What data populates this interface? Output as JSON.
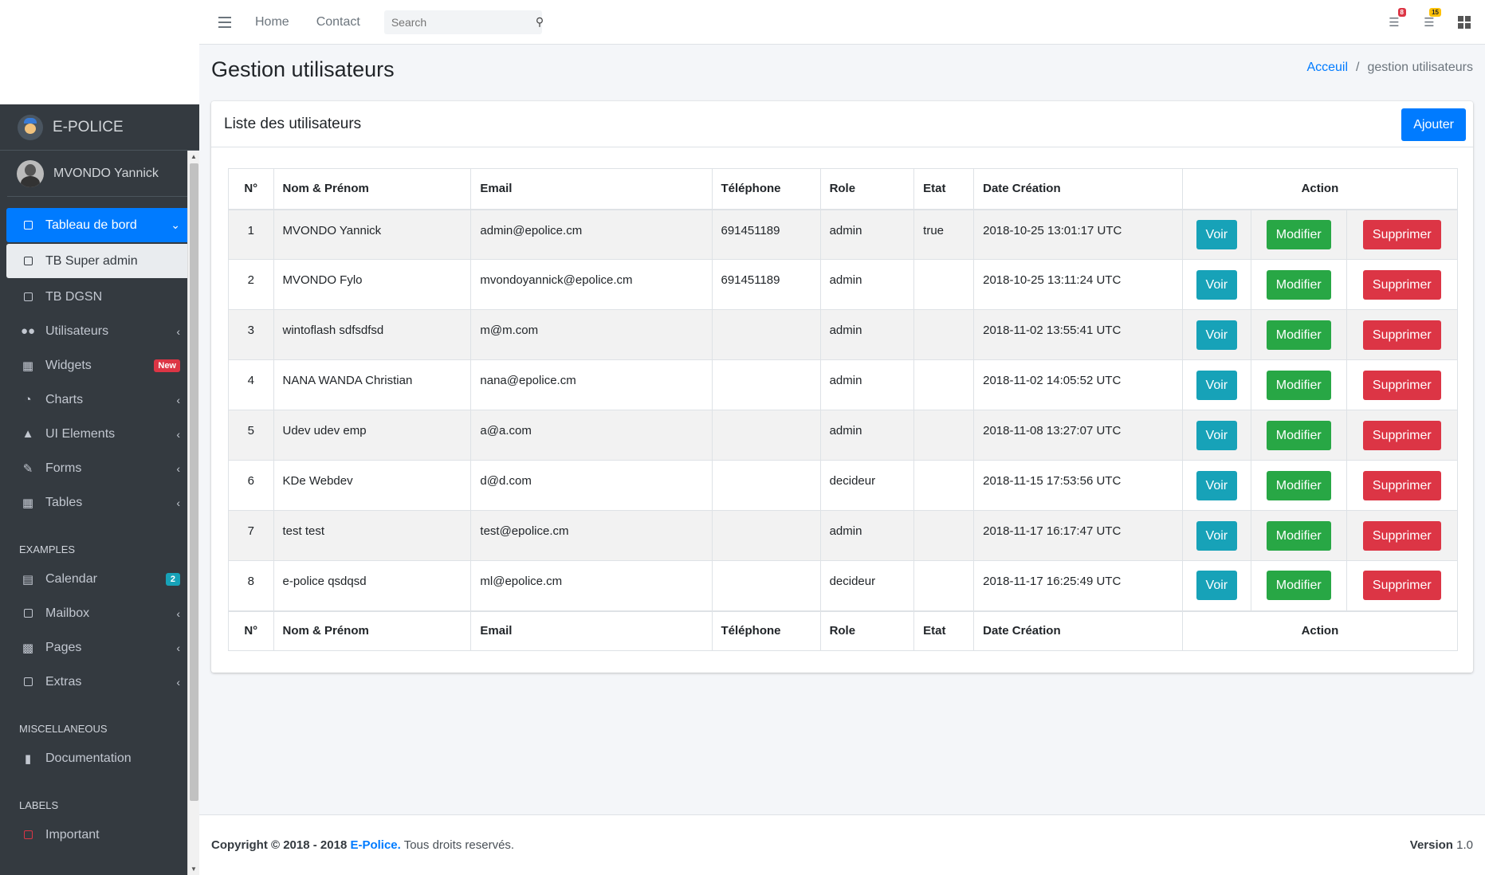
{
  "brand": {
    "name": "E-POLICE"
  },
  "user": {
    "name": "MVONDO Yannick"
  },
  "sidebar": {
    "items": [
      {
        "label": "Tableau de bord"
      },
      {
        "label": "TB Super admin"
      },
      {
        "label": "TB DGSN"
      },
      {
        "label": "Utilisateurs"
      },
      {
        "label": "Widgets",
        "badge": "New"
      },
      {
        "label": "Charts"
      },
      {
        "label": "UI Elements"
      },
      {
        "label": "Forms"
      },
      {
        "label": "Tables"
      },
      {
        "label": "Calendar",
        "badge": "2"
      },
      {
        "label": "Mailbox"
      },
      {
        "label": "Pages"
      },
      {
        "label": "Extras"
      },
      {
        "label": "Documentation"
      },
      {
        "label": "Important"
      }
    ],
    "headers": [
      "EXAMPLES",
      "MISCELLANEOUS",
      "LABELS"
    ]
  },
  "topbar": {
    "links": [
      "Home",
      "Contact"
    ],
    "search_placeholder": "Search",
    "notif_badges": [
      "8",
      "15"
    ]
  },
  "page": {
    "title": "Gestion utilisateurs",
    "breadcrumb": [
      "Acceuil",
      "/",
      "gestion utilisateurs"
    ]
  },
  "card": {
    "title": "Liste des utilisateurs",
    "add_label": "Ajouter"
  },
  "table": {
    "headers": [
      "N°",
      "Nom & Prénom",
      "Email",
      "Téléphone",
      "Role",
      "Etat",
      "Date Création",
      "Action"
    ],
    "actions": [
      "Voir",
      "Modifier",
      "Supprimer"
    ],
    "rows": [
      {
        "n": "1",
        "name": "MVONDO Yannick",
        "email": "admin@epolice.cm",
        "tel": "691451189",
        "role": "admin",
        "etat": "true",
        "date": "2018-10-25 13:01:17 UTC"
      },
      {
        "n": "2",
        "name": "MVONDO Fylo",
        "email": "mvondoyannick@epolice.cm",
        "tel": "691451189",
        "role": "admin",
        "etat": "",
        "date": "2018-10-25 13:11:24 UTC"
      },
      {
        "n": "3",
        "name": "wintoflash sdfsdfsd",
        "email": "m@m.com",
        "tel": "",
        "role": "admin",
        "etat": "",
        "date": "2018-11-02 13:55:41 UTC"
      },
      {
        "n": "4",
        "name": "NANA WANDA Christian",
        "email": "nana@epolice.cm",
        "tel": "",
        "role": "admin",
        "etat": "",
        "date": "2018-11-02 14:05:52 UTC"
      },
      {
        "n": "5",
        "name": "Udev udev emp",
        "email": "a@a.com",
        "tel": "",
        "role": "admin",
        "etat": "",
        "date": "2018-11-08 13:27:07 UTC"
      },
      {
        "n": "6",
        "name": "KDe Webdev",
        "email": "d@d.com",
        "tel": "",
        "role": "decideur",
        "etat": "",
        "date": "2018-11-15 17:53:56 UTC"
      },
      {
        "n": "7",
        "name": "test test",
        "email": "test@epolice.cm",
        "tel": "",
        "role": "admin",
        "etat": "",
        "date": "2018-11-17 16:17:47 UTC"
      },
      {
        "n": "8",
        "name": "e-police qsdqsd",
        "email": "ml@epolice.cm",
        "tel": "",
        "role": "decideur",
        "etat": "",
        "date": "2018-11-17 16:25:49 UTC"
      }
    ]
  },
  "footer": {
    "copyright": "Copyright © 2018 - 2018",
    "brand_link": "E-Police.",
    "rights": "Tous droits reservés.",
    "version_label": "Version",
    "version_value": "1.0"
  },
  "colors": {
    "primary": "#007bff",
    "info": "#17a2b8",
    "success": "#28a745",
    "danger": "#dc3545",
    "sidebar": "#343a40"
  }
}
